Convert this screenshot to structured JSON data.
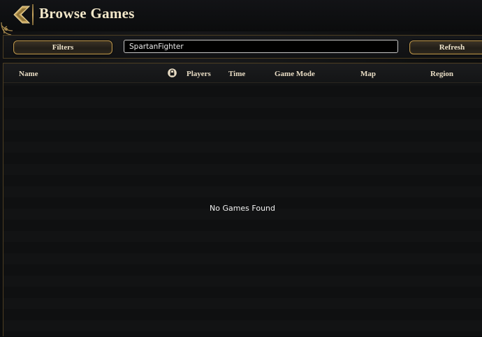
{
  "header": {
    "title": "Browse Games",
    "back_icon": "chevron-left-icon"
  },
  "toolbar": {
    "filters_label": "Filters",
    "search_value": "SpartanFighter",
    "refresh_label": "Refresh"
  },
  "table": {
    "columns": {
      "name": "Name",
      "lock_icon": "lock-icon",
      "players": "Players",
      "time": "Time",
      "game_mode": "Game Mode",
      "map": "Map",
      "region": "Region"
    },
    "empty_message": "No Games Found"
  },
  "colors": {
    "gold_accent": "#b8944f",
    "title_text": "#f2e7c9",
    "background": "#0d0e0f"
  }
}
